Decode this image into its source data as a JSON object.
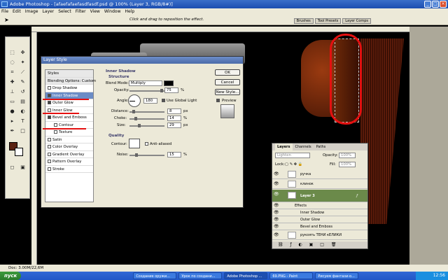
{
  "window": {
    "title": "Adobe Photoshop - [afaefafaefasdfasdf.psd @ 100% (Layer 3, RGB/8#)]",
    "minimize": "_",
    "maximize": "□",
    "close": "×"
  },
  "menu": [
    "File",
    "Edit",
    "Image",
    "Layer",
    "Select",
    "Filter",
    "View",
    "Window",
    "Help"
  ],
  "options": {
    "hint": "Click and drag to reposition the effect.",
    "palette_tabs": [
      "Brushes",
      "Tool Presets",
      "Layer Comps"
    ]
  },
  "dialog": {
    "title": "Layer Style",
    "styles": [
      {
        "label": "Styles",
        "type": "head"
      },
      {
        "label": "Blending Options: Custom",
        "type": "head"
      },
      {
        "label": "Drop Shadow",
        "checked": false
      },
      {
        "label": "Inner Shadow",
        "checked": true,
        "selected": true
      },
      {
        "label": "Outer Glow",
        "checked": true
      },
      {
        "label": "Inner Glow",
        "checked": false
      },
      {
        "label": "Bevel and Emboss",
        "checked": true
      },
      {
        "label": "Contour",
        "checked": false,
        "sub": true
      },
      {
        "label": "Texture",
        "checked": false,
        "sub": true
      },
      {
        "label": "Satin",
        "checked": false
      },
      {
        "label": "Color Overlay",
        "checked": false
      },
      {
        "label": "Gradient Overlay",
        "checked": false
      },
      {
        "label": "Pattern Overlay",
        "checked": false
      },
      {
        "label": "Stroke",
        "checked": false
      }
    ],
    "section": "Inner Shadow",
    "structure": "Structure",
    "blend_mode_label": "Blend Mode:",
    "blend_mode": "Multiply",
    "opacity_label": "Opacity:",
    "opacity": "75",
    "percent": "%",
    "angle_label": "Angle:",
    "angle": "180",
    "global_light": "Use Global Light",
    "distance_label": "Distance:",
    "distance": "8",
    "choke_label": "Choke:",
    "choke": "14",
    "size_label": "Size:",
    "size": "29",
    "px": "px",
    "quality": "Quality",
    "contour_label": "Contour:",
    "anti_aliased": "Anti-aliased",
    "noise_label": "Noise:",
    "noise": "15",
    "ok": "OK",
    "cancel": "Cancel",
    "new_style": "New Style...",
    "preview": "Preview"
  },
  "layers": {
    "tabs": [
      "Layers",
      "Channels",
      "Paths"
    ],
    "blend": "Lighten",
    "opacity_label": "Opacity:",
    "opacity": "100%",
    "lock_label": "Lock:",
    "fill_label": "Fill:",
    "fill": "100%",
    "rows": [
      {
        "name": "ручка",
        "kind": "layer"
      },
      {
        "name": "клинок",
        "kind": "layer"
      },
      {
        "name": "",
        "kind": "layer"
      },
      {
        "name": "Layer 3",
        "kind": "layer",
        "selected": true
      },
      {
        "name": "Effects",
        "kind": "fx"
      },
      {
        "name": "Inner Shadow",
        "kind": "fx2"
      },
      {
        "name": "Outer Glow",
        "kind": "fx2"
      },
      {
        "name": "Bevel and Emboss",
        "kind": "fx2"
      },
      {
        "name": "рукоять ТЕНИ кЕЛИКИ",
        "kind": "layer"
      }
    ]
  },
  "status": "Doc: 3.00M/22,6M",
  "taskbar": {
    "start": "пуск",
    "tasks": [
      "Создание оружи...",
      "Урок по создани...",
      "Adobe Photoshop ...",
      "69.PNG - Paint",
      "Рисуем фантази-о..."
    ],
    "clock": "12:56"
  },
  "colors": {
    "accent": "#e41010",
    "foreground": "#5a2212"
  }
}
